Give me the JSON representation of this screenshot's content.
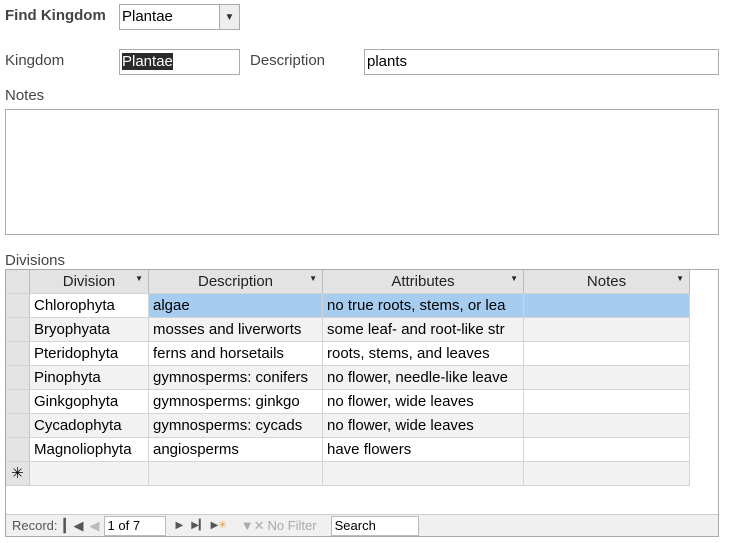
{
  "find": {
    "label": "Find Kingdom",
    "value": "Plantae"
  },
  "kingdom": {
    "label": "Kingdom",
    "value": "Plantae"
  },
  "description": {
    "label": "Description",
    "value": "plants"
  },
  "notes": {
    "label": "Notes",
    "value": ""
  },
  "divisions": {
    "label": "Divisions",
    "columns": [
      "Division",
      "Description",
      "Attributes",
      "Notes"
    ],
    "rows": [
      [
        "Chlorophyta",
        "algae",
        "no true roots, stems, or lea",
        ""
      ],
      [
        "Bryophyata",
        "mosses and liverworts",
        "some leaf- and root-like str",
        ""
      ],
      [
        "Pteridophyta",
        "ferns and horsetails",
        "roots, stems, and leaves",
        ""
      ],
      [
        "Pinophyta",
        "gymnosperms: conifers",
        "no flower, needle-like leave",
        ""
      ],
      [
        "Ginkgophyta",
        "gymnosperms: ginkgo",
        "no flower, wide leaves",
        ""
      ],
      [
        "Cycadophyta",
        "gymnosperms: cycads",
        "no flower, wide leaves",
        ""
      ],
      [
        "Magnoliophyta",
        "angiosperms",
        "have flowers",
        ""
      ]
    ]
  },
  "nav": {
    "record_label": "Record:",
    "position": "1 of 7",
    "filter": "No Filter",
    "search": "Search"
  }
}
